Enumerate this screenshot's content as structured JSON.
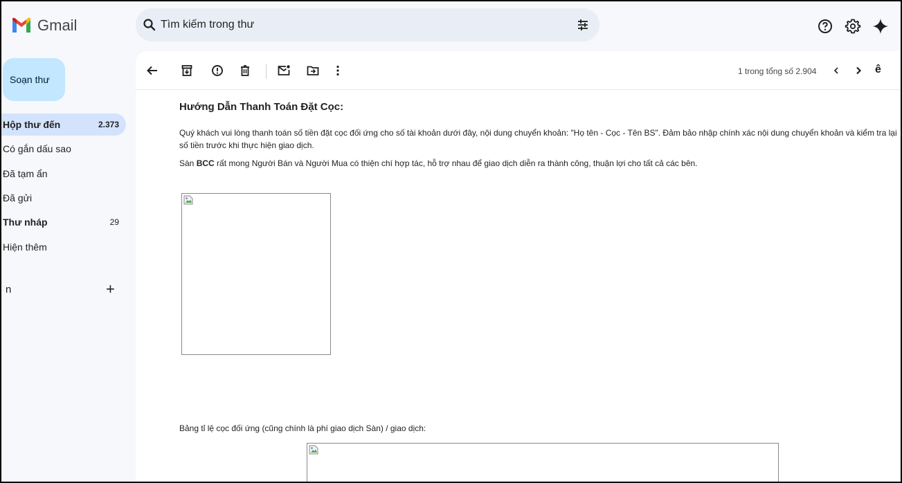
{
  "app": {
    "name": "Gmail"
  },
  "search": {
    "placeholder": "Tìm kiếm trong thư"
  },
  "sidebar": {
    "compose_label": "Soạn thư",
    "items": [
      {
        "label": "Hộp thư đến",
        "count": "2.373"
      },
      {
        "label": "Có gắn dấu sao",
        "count": ""
      },
      {
        "label": "Đã tạm ẩn",
        "count": ""
      },
      {
        "label": "Đã gửi",
        "count": ""
      },
      {
        "label": "Thư nháp",
        "count": "29"
      },
      {
        "label": "Hiện thêm",
        "count": ""
      }
    ],
    "labels_title": "n",
    "labels_add": "+"
  },
  "toolbar": {
    "pager_text": "1 trong tổng số 2.904",
    "trailing_text": "ê"
  },
  "email": {
    "title": "Hướng Dẫn Thanh Toán Đặt Cọc:",
    "paragraph1": "Quý khách vui lòng thanh toán số tiền đặt cọc đối ứng cho số tài khoản dưới đây, nội dung chuyển khoản: \"Họ tên - Cọc - Tên BS\". Đảm bảo nhập chính xác nội dung chuyển khoản và kiểm tra lại số tiền trước khi thực hiện giao dịch.",
    "paragraph2_prefix": "Sàn ",
    "paragraph2_bold": "BCC",
    "paragraph2_suffix": " rất mong Người Bán và Người Mua có thiện chí hợp tác, hỗ trợ nhau để giao dịch diễn ra thành công, thuận lợi cho tất cả các bên.",
    "table_label": "Bảng tỉ lệ cọc đối ứng (cũng chính là phí giao dịch Sàn) / giao dịch:"
  },
  "colors": {
    "compose_bg": "#c2e7ff",
    "active_nav_bg": "#d3e3fd",
    "search_bg": "#e9eef6",
    "page_bg": "#f6f8fc"
  }
}
